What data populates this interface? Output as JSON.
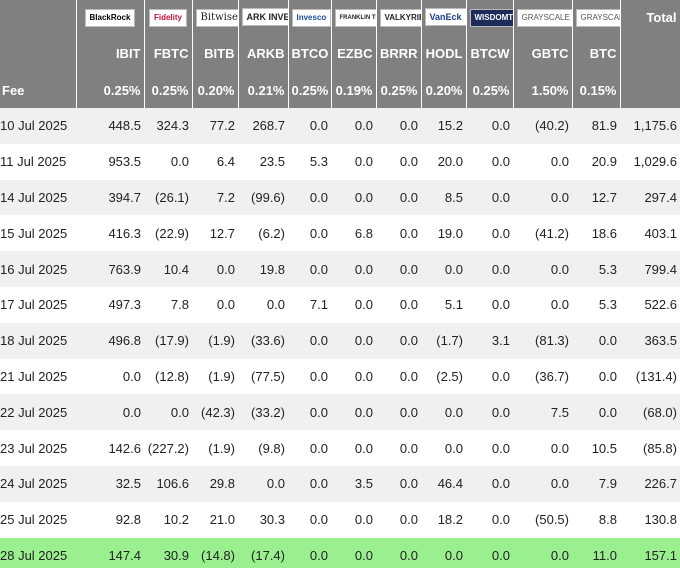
{
  "header": {
    "issuers": [
      {
        "name": "BlackRock",
        "icon": "blackrock-logo"
      },
      {
        "name": "Fidelity",
        "icon": "fidelity-logo"
      },
      {
        "name": "Bitwise",
        "icon": "bitwise-logo"
      },
      {
        "name": "ARK INVEST",
        "icon": "ark-logo"
      },
      {
        "name": "Invesco",
        "icon": "invesco-logo"
      },
      {
        "name": "FRANKLIN TEMPLETON",
        "icon": "franklin-logo"
      },
      {
        "name": "VALKYRIE",
        "icon": "valkyrie-logo"
      },
      {
        "name": "VanEck",
        "icon": "vaneck-logo"
      },
      {
        "name": "WISDOMTREE",
        "icon": "wisdomtree-logo"
      },
      {
        "name": "GRAYSCALE",
        "icon": "grayscale-logo"
      },
      {
        "name": "GRAYSCALE",
        "icon": "grayscale-logo"
      }
    ],
    "total_label": "Total",
    "tickers": [
      "IBIT",
      "FBTC",
      "BITB",
      "ARKB",
      "BTCO",
      "EZBC",
      "BRRR",
      "HODL",
      "BTCW",
      "GBTC",
      "BTC"
    ],
    "fee_label": "Fee",
    "fees": [
      "0.25%",
      "0.25%",
      "0.20%",
      "0.21%",
      "0.25%",
      "0.19%",
      "0.25%",
      "0.20%",
      "0.25%",
      "1.50%",
      "0.15%"
    ]
  },
  "rows": [
    {
      "date": "10 Jul 2025",
      "values": [
        "448.5",
        "324.3",
        "77.2",
        "268.7",
        "0.0",
        "0.0",
        "0.0",
        "15.2",
        "0.0",
        "(40.2)",
        "81.9"
      ],
      "total": "1,175.6"
    },
    {
      "date": "11 Jul 2025",
      "values": [
        "953.5",
        "0.0",
        "6.4",
        "23.5",
        "5.3",
        "0.0",
        "0.0",
        "20.0",
        "0.0",
        "0.0",
        "20.9"
      ],
      "total": "1,029.6"
    },
    {
      "date": "14 Jul 2025",
      "values": [
        "394.7",
        "(26.1)",
        "7.2",
        "(99.6)",
        "0.0",
        "0.0",
        "0.0",
        "8.5",
        "0.0",
        "0.0",
        "12.7"
      ],
      "total": "297.4"
    },
    {
      "date": "15 Jul 2025",
      "values": [
        "416.3",
        "(22.9)",
        "12.7",
        "(6.2)",
        "0.0",
        "6.8",
        "0.0",
        "19.0",
        "0.0",
        "(41.2)",
        "18.6"
      ],
      "total": "403.1"
    },
    {
      "date": "16 Jul 2025",
      "values": [
        "763.9",
        "10.4",
        "0.0",
        "19.8",
        "0.0",
        "0.0",
        "0.0",
        "0.0",
        "0.0",
        "0.0",
        "5.3"
      ],
      "total": "799.4"
    },
    {
      "date": "17 Jul 2025",
      "values": [
        "497.3",
        "7.8",
        "0.0",
        "0.0",
        "7.1",
        "0.0",
        "0.0",
        "5.1",
        "0.0",
        "0.0",
        "5.3"
      ],
      "total": "522.6"
    },
    {
      "date": "18 Jul 2025",
      "values": [
        "496.8",
        "(17.9)",
        "(1.9)",
        "(33.6)",
        "0.0",
        "0.0",
        "0.0",
        "(1.7)",
        "3.1",
        "(81.3)",
        "0.0"
      ],
      "total": "363.5"
    },
    {
      "date": "21 Jul 2025",
      "values": [
        "0.0",
        "(12.8)",
        "(1.9)",
        "(77.5)",
        "0.0",
        "0.0",
        "0.0",
        "(2.5)",
        "0.0",
        "(36.7)",
        "0.0"
      ],
      "total": "(131.4)"
    },
    {
      "date": "22 Jul 2025",
      "values": [
        "0.0",
        "0.0",
        "(42.3)",
        "(33.2)",
        "0.0",
        "0.0",
        "0.0",
        "0.0",
        "0.0",
        "7.5",
        "0.0"
      ],
      "total": "(68.0)"
    },
    {
      "date": "23 Jul 2025",
      "values": [
        "142.6",
        "(227.2)",
        "(1.9)",
        "(9.8)",
        "0.0",
        "0.0",
        "0.0",
        "0.0",
        "0.0",
        "0.0",
        "10.5"
      ],
      "total": "(85.8)"
    },
    {
      "date": "24 Jul 2025",
      "values": [
        "32.5",
        "106.6",
        "29.8",
        "0.0",
        "0.0",
        "3.5",
        "0.0",
        "46.4",
        "0.0",
        "0.0",
        "7.9"
      ],
      "total": "226.7"
    },
    {
      "date": "25 Jul 2025",
      "values": [
        "92.8",
        "10.2",
        "21.0",
        "30.3",
        "0.0",
        "0.0",
        "0.0",
        "18.2",
        "0.0",
        "(50.5)",
        "8.8"
      ],
      "total": "130.8"
    },
    {
      "date": "28 Jul 2025",
      "values": [
        "147.4",
        "30.9",
        "(14.8)",
        "(17.4)",
        "0.0",
        "0.0",
        "0.0",
        "0.0",
        "0.0",
        "0.0",
        "11.0"
      ],
      "total": "157.1",
      "highlight": true
    }
  ],
  "colors": {
    "header_bg": "#808080",
    "negative": "#d62020",
    "row_alt": "#f0f0f0",
    "highlight": "#9af08f"
  }
}
